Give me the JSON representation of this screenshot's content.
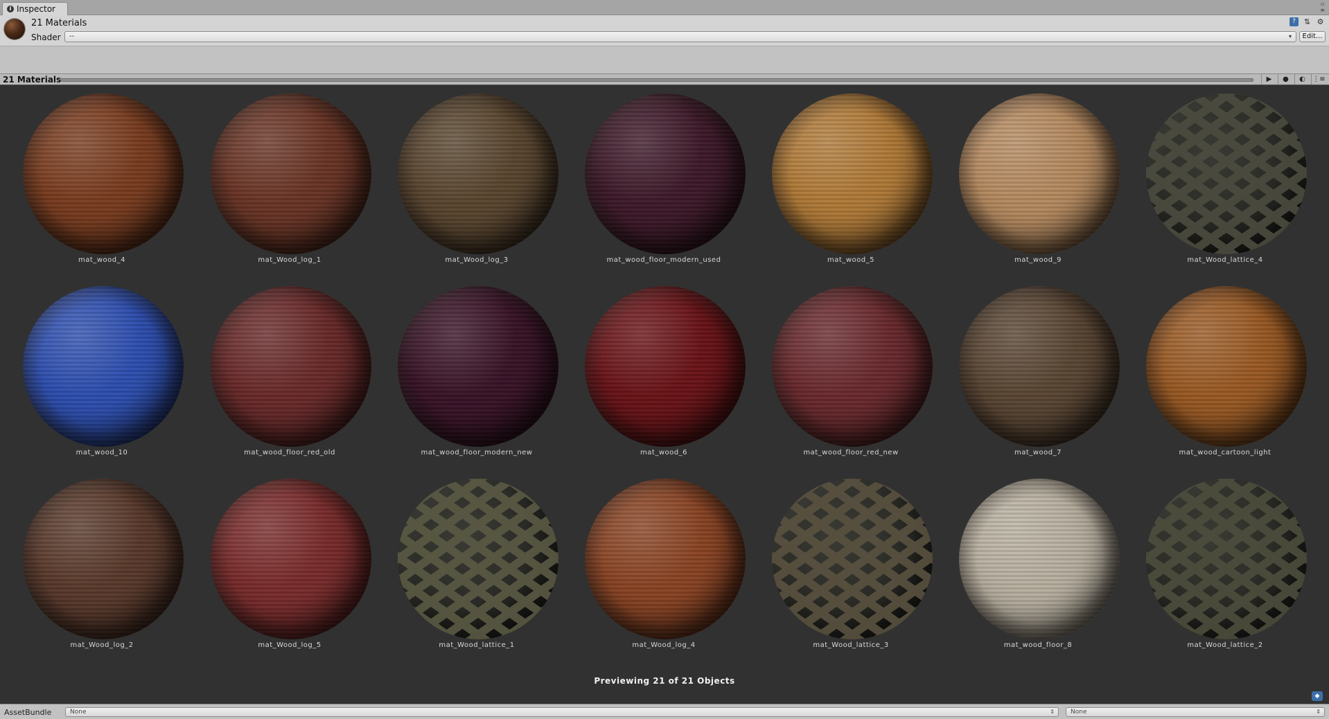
{
  "tab": {
    "label": "Inspector"
  },
  "header": {
    "title": "21 Materials",
    "shader_label": "Shader",
    "shader_value": "--",
    "edit_label": "Edit..."
  },
  "preview": {
    "title": "21 Materials",
    "status": "Previewing 21 of 21 Objects",
    "materials": [
      {
        "name": "mat_wood_4",
        "color": "#7a3d20"
      },
      {
        "name": "mat_Wood_log_1",
        "color": "#6a3526"
      },
      {
        "name": "mat_Wood_log_3",
        "color": "#5a4630"
      },
      {
        "name": "mat_wood_floor_modern_used",
        "color": "#3f1a2a"
      },
      {
        "name": "mat_wood_5",
        "color": "#b07a38"
      },
      {
        "name": "mat_wood_9",
        "color": "#b58a60"
      },
      {
        "name": "mat_Wood_lattice_4",
        "color": "#4c4c40",
        "lattice": true
      },
      {
        "name": "mat_wood_10",
        "color": "#2e4fb0"
      },
      {
        "name": "mat_wood_floor_red_old",
        "color": "#6a2a2a"
      },
      {
        "name": "mat_wood_floor_modern_new",
        "color": "#3a1428"
      },
      {
        "name": "mat_wood_6",
        "color": "#6a1418"
      },
      {
        "name": "mat_wood_floor_red_new",
        "color": "#6a2a2e"
      },
      {
        "name": "mat_wood_7",
        "color": "#5a4634"
      },
      {
        "name": "mat_wood_cartoon_light",
        "color": "#9a5a24"
      },
      {
        "name": "mat_Wood_log_2",
        "color": "#5a3a2c"
      },
      {
        "name": "mat_Wood_log_5",
        "color": "#7a2c2c"
      },
      {
        "name": "mat_Wood_lattice_1",
        "color": "#5a5a44",
        "lattice": true
      },
      {
        "name": "mat_Wood_log_4",
        "color": "#8a4424"
      },
      {
        "name": "mat_Wood_lattice_3",
        "color": "#5a5240",
        "lattice": true
      },
      {
        "name": "mat_wood_floor_8",
        "color": "#b8b0a0"
      },
      {
        "name": "mat_Wood_lattice_2",
        "color": "#4e4e3e",
        "lattice": true
      }
    ]
  },
  "bottom": {
    "label": "AssetBundle",
    "bundle_value": "None",
    "variant_value": "None"
  }
}
